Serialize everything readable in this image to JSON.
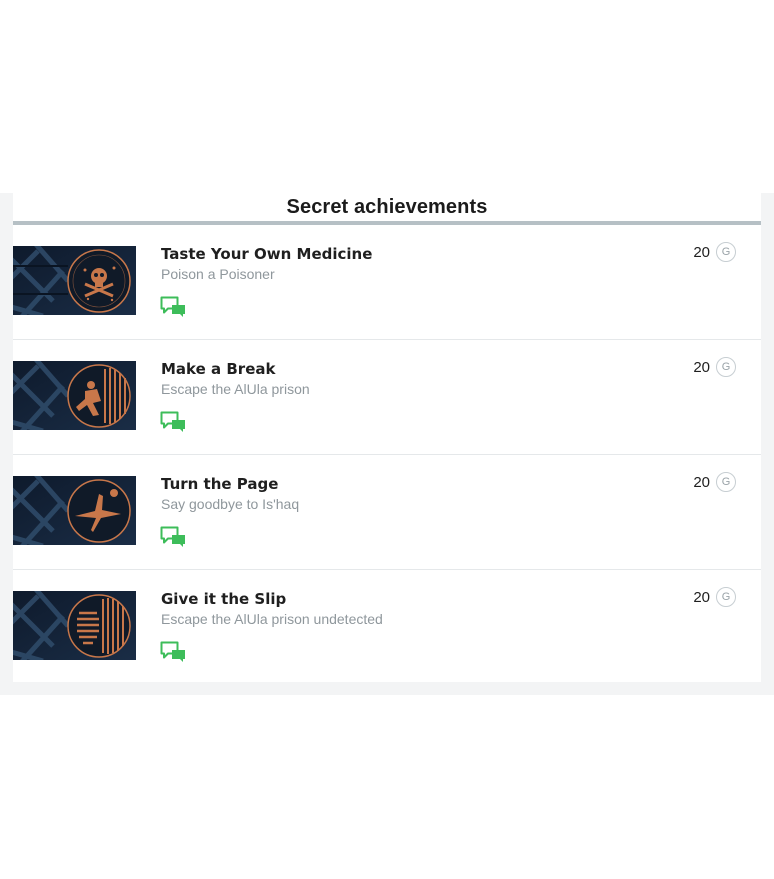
{
  "section": {
    "title": "Secret achievements"
  },
  "score_unit_icon": "G",
  "achievements": [
    {
      "name": "Taste Your Own Medicine",
      "description": "Poison a Poisoner",
      "score": "20",
      "icon": "skull-crossbones-emblem",
      "comment_icon": "speech-bubbles-icon"
    },
    {
      "name": "Make a Break",
      "description": "Escape the AlUla prison",
      "score": "20",
      "icon": "running-figure-bars-emblem",
      "comment_icon": "speech-bubbles-icon"
    },
    {
      "name": "Turn the Page",
      "description": "Say goodbye to Is'haq",
      "score": "20",
      "icon": "flying-figure-emblem",
      "comment_icon": "speech-bubbles-icon"
    },
    {
      "name": "Give it the Slip",
      "description": "Escape the AlUla prison undetected",
      "score": "20",
      "icon": "sneaking-figure-bars-emblem",
      "comment_icon": "speech-bubbles-icon"
    }
  ],
  "colors": {
    "accent_green": "#3dbd5a",
    "header_rule": "#b6c0c5",
    "emblem_copper": "#c8774a",
    "thumb_dark": "#12223a"
  }
}
